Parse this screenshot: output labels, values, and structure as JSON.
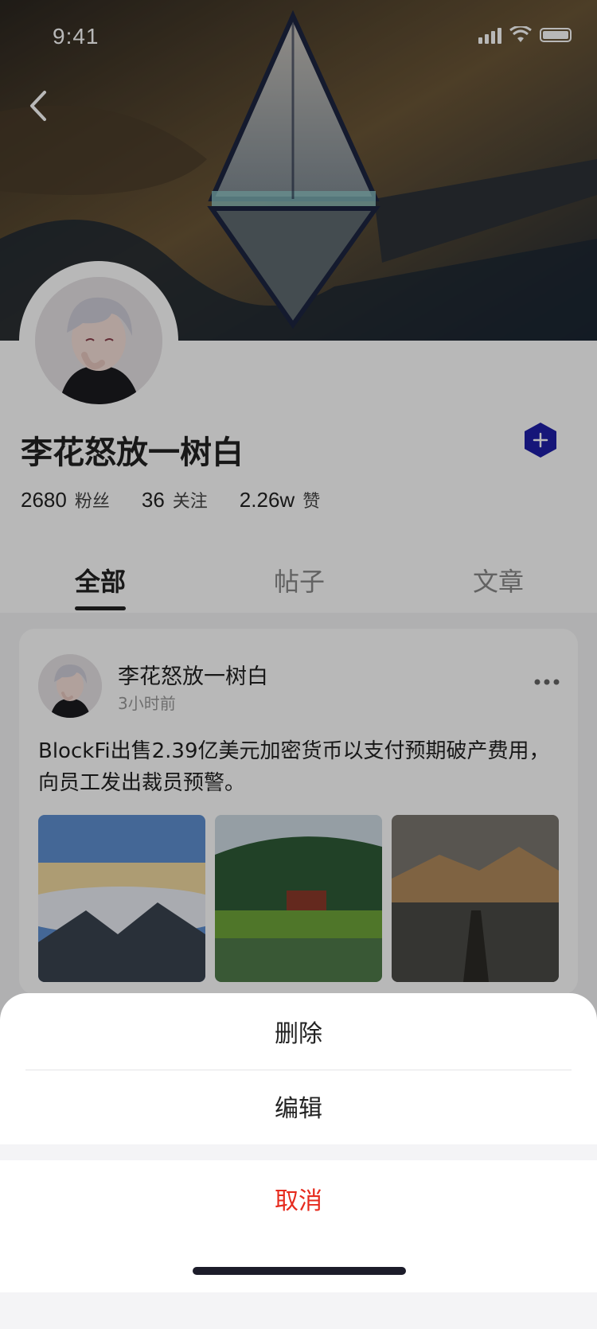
{
  "status_bar": {
    "time": "9:41"
  },
  "profile": {
    "name": "李花怒放一树白",
    "stats": [
      {
        "value": "2680",
        "label": "粉丝"
      },
      {
        "value": "36",
        "label": "关注"
      },
      {
        "value": "2.26w",
        "label": "赞"
      }
    ],
    "follow_icon": "plus-icon"
  },
  "tabs": [
    {
      "label": "全部",
      "active": true
    },
    {
      "label": "帖子",
      "active": false
    },
    {
      "label": "文章",
      "active": false
    }
  ],
  "post": {
    "author": "李花怒放一树白",
    "time": "3小时前",
    "text": "BlockFi出售2.39亿美元加密货币以支付预期破产费用，向员工发出裁员预警。",
    "images": [
      "sea-of-clouds-photo",
      "lake-village-photo",
      "misty-pier-photo"
    ]
  },
  "action_sheet": {
    "items": [
      "删除",
      "编辑"
    ],
    "cancel": "取消"
  },
  "colors": {
    "accent": "#1f1fa8",
    "cancel": "#e62b1e",
    "text": "#222222",
    "muted": "#999999"
  }
}
